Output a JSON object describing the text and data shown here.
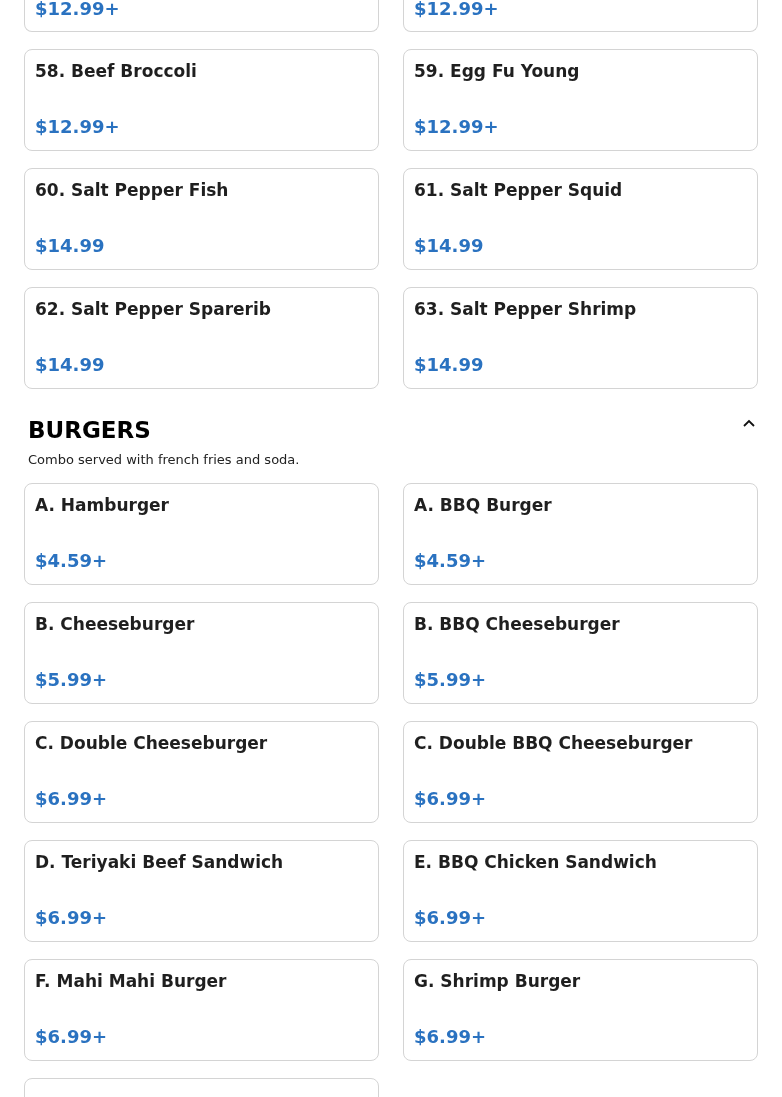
{
  "sections": [
    {
      "items": [
        {
          "price": "$12.99+"
        },
        {
          "price": "$12.99+"
        },
        {
          "name": "58. Beef Broccoli",
          "price": "$12.99+"
        },
        {
          "name": "59. Egg Fu Young",
          "price": "$12.99+"
        },
        {
          "name": "60. Salt Pepper Fish",
          "price": "$14.99"
        },
        {
          "name": "61. Salt Pepper Squid",
          "price": "$14.99"
        },
        {
          "name": "62. Salt Pepper Sparerib",
          "price": "$14.99"
        },
        {
          "name": "63. Salt Pepper Shrimp",
          "price": "$14.99"
        }
      ]
    },
    {
      "title": "BURGERS",
      "description": "Combo served with french fries and soda.",
      "expanded": true,
      "items": [
        {
          "name": "A. Hamburger",
          "price": "$4.59+"
        },
        {
          "name": "A. BBQ Burger",
          "price": "$4.59+"
        },
        {
          "name": "B. Cheeseburger",
          "price": "$5.99+"
        },
        {
          "name": "B. BBQ Cheeseburger",
          "price": "$5.99+"
        },
        {
          "name": "C. Double Cheeseburger",
          "price": "$6.99+"
        },
        {
          "name": "C. Double BBQ Cheeseburger",
          "price": "$6.99+"
        },
        {
          "name": "D. Teriyaki Beef Sandwich",
          "price": "$6.99+"
        },
        {
          "name": "E. BBQ Chicken Sandwich",
          "price": "$6.99+"
        },
        {
          "name": "F. Mahi Mahi Burger",
          "price": "$6.99+"
        },
        {
          "name": "G. Shrimp Burger",
          "price": "$6.99+"
        },
        {
          "kind": "cut"
        }
      ]
    }
  ]
}
